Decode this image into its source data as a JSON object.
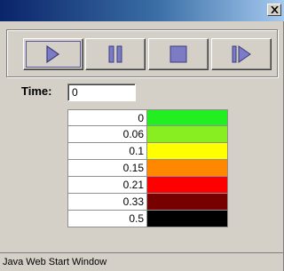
{
  "window": {
    "status_text": "Java Web Start Window"
  },
  "toolbar": {
    "buttons": [
      {
        "name": "play",
        "icon": "play-icon"
      },
      {
        "name": "pause",
        "icon": "pause-icon"
      },
      {
        "name": "stop",
        "icon": "stop-icon"
      },
      {
        "name": "step",
        "icon": "step-forward-icon"
      }
    ]
  },
  "time": {
    "label": "Time:",
    "value": "0"
  },
  "legend": {
    "rows": [
      {
        "value": "0",
        "color": "#22ee22"
      },
      {
        "value": "0.06",
        "color": "#88ee22"
      },
      {
        "value": "0.1",
        "color": "#ffff00"
      },
      {
        "value": "0.15",
        "color": "#ff8800"
      },
      {
        "value": "0.21",
        "color": "#ff0000"
      },
      {
        "value": "0.33",
        "color": "#770000"
      },
      {
        "value": "0.5",
        "color": "#000000"
      }
    ]
  },
  "colors": {
    "titlebar": "#0a246a",
    "chrome": "#d4d0c8",
    "icon": "#7b7bc6"
  }
}
